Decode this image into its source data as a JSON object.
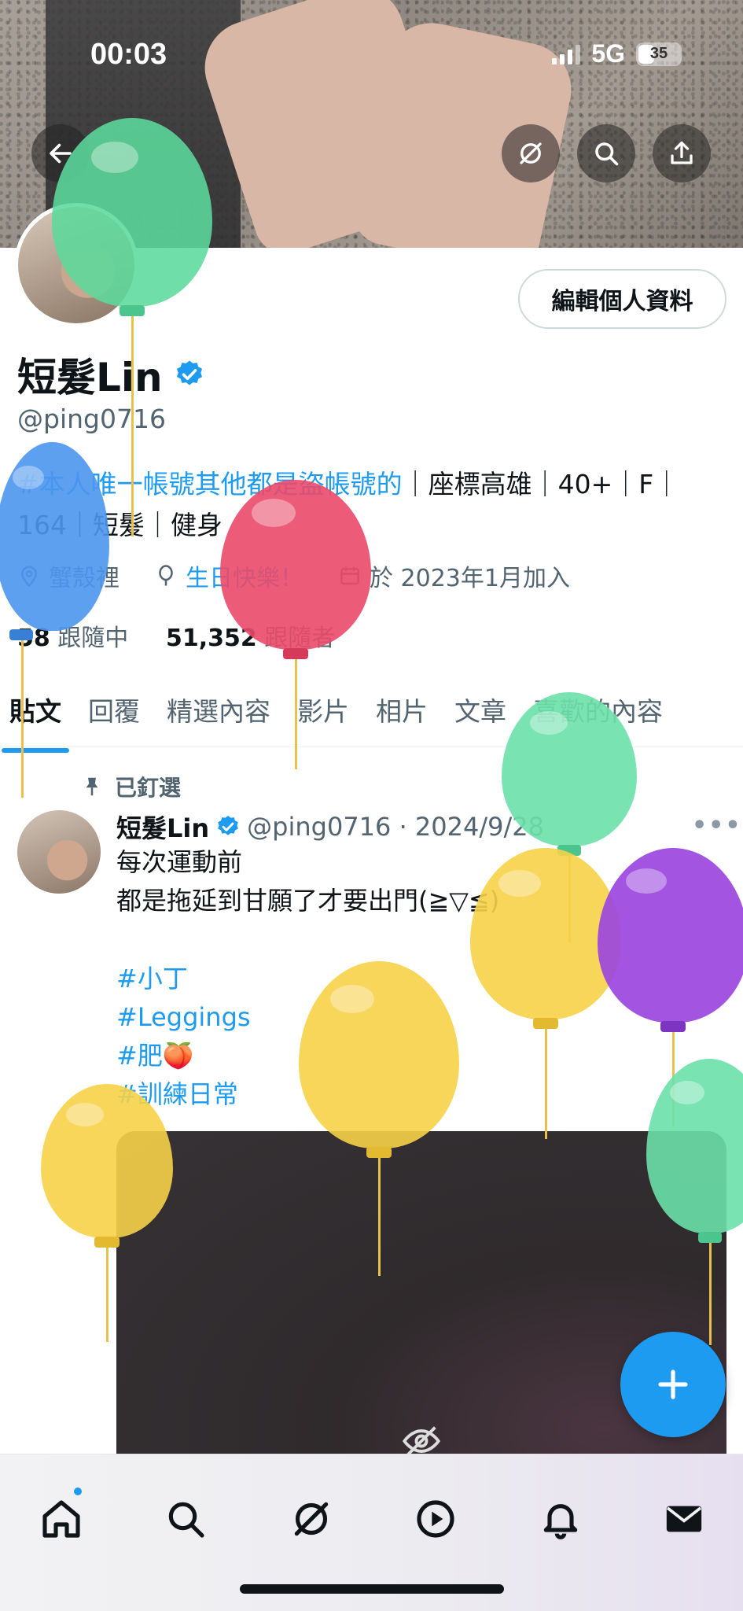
{
  "status_bar": {
    "time": "00:03",
    "network": "5G",
    "battery": "35"
  },
  "profile": {
    "edit_button": "編輯個人資料",
    "name": "短髮Lin",
    "handle": "@ping0716",
    "bio_hashtag": "#本人唯一帳號其他都是盜帳號的",
    "bio_rest": "｜座標高雄｜40+｜F｜164｜短髮｜健身",
    "location": "蟹殼裡",
    "birthday": "生日快樂！",
    "joined": "於 2023年1月加入",
    "following_count": "58",
    "following_label": "跟隨中",
    "followers_count": "51,352",
    "followers_label": "跟隨者"
  },
  "tabs": [
    "貼文",
    "回覆",
    "精選內容",
    "影片",
    "相片",
    "文章",
    "喜歡的內容"
  ],
  "pinned_post": {
    "pinned_label": "已釘選",
    "author": "短髮Lin",
    "handle_date": "@ping0716 · 2024/9/28",
    "text": "每次運動前\n都是拖延到甘願了才要出門(≧▽≦)",
    "hashtags": [
      "#小丁",
      "#Leggings",
      "#肥🍑",
      "#訓練日常"
    ]
  },
  "icons": {
    "back": "back-arrow-icon",
    "grok": "grok-icon",
    "search": "search-icon",
    "share": "share-icon",
    "verified": "verified-badge-icon",
    "location": "location-pin-icon",
    "birthday": "balloon-icon",
    "calendar": "calendar-icon",
    "pin": "pin-icon",
    "hidden_media": "eye-slash-icon",
    "compose": "plus-icon",
    "nav": [
      "home-icon",
      "search-icon",
      "grok-icon",
      "video-play-icon",
      "bell-icon",
      "mail-icon"
    ]
  },
  "colors": {
    "accent": "#1d9bf0",
    "text": "#0f1419",
    "secondary": "#536471"
  }
}
